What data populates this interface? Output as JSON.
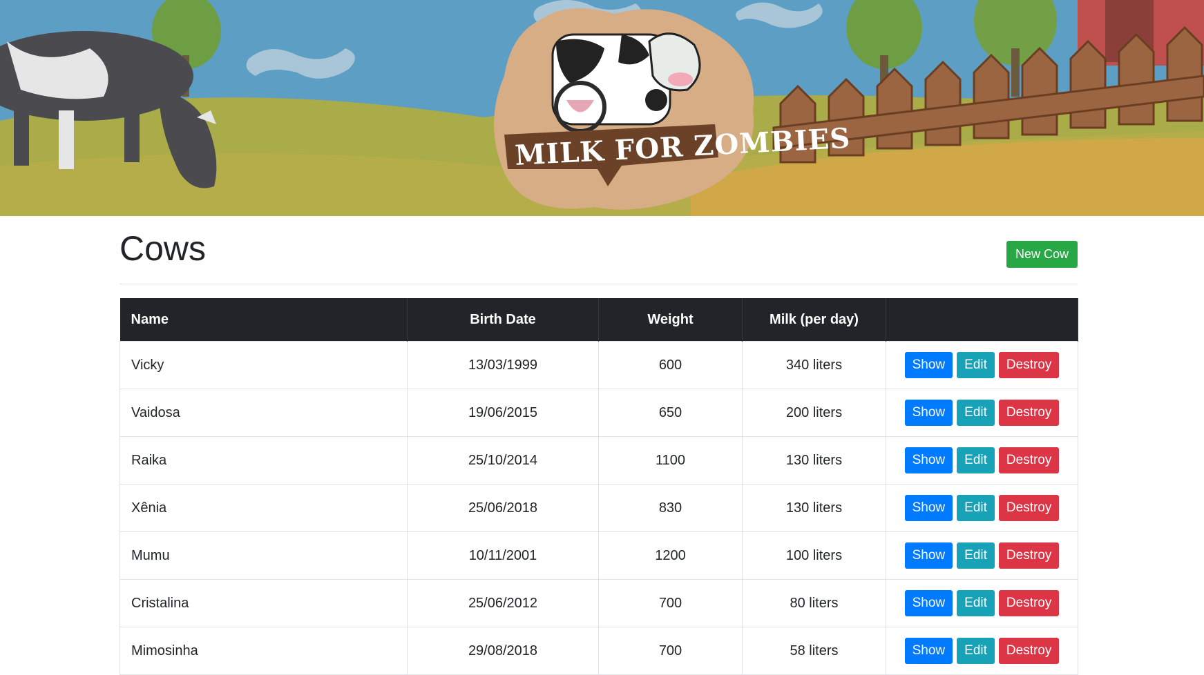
{
  "banner": {
    "logo_text": "MILK FOR ZOMBIES"
  },
  "page": {
    "title": "Cows",
    "new_button": "New Cow"
  },
  "table": {
    "headers": [
      "Name",
      "Birth Date",
      "Weight",
      "Milk (per day)",
      ""
    ],
    "rows": [
      {
        "name": "Vicky",
        "birth_date": "13/03/1999",
        "weight": "600",
        "milk": "340 liters"
      },
      {
        "name": "Vaidosa",
        "birth_date": "19/06/2015",
        "weight": "650",
        "milk": "200 liters"
      },
      {
        "name": "Raika",
        "birth_date": "25/10/2014",
        "weight": "1100",
        "milk": "130 liters"
      },
      {
        "name": "Xênia",
        "birth_date": "25/06/2018",
        "weight": "830",
        "milk": "130 liters"
      },
      {
        "name": "Mumu",
        "birth_date": "10/11/2001",
        "weight": "1200",
        "milk": "100 liters"
      },
      {
        "name": "Cristalina",
        "birth_date": "25/06/2012",
        "weight": "700",
        "milk": "80 liters"
      },
      {
        "name": "Mimosinha",
        "birth_date": "29/08/2018",
        "weight": "700",
        "milk": "58 liters"
      }
    ],
    "actions": {
      "show": "Show",
      "edit": "Edit",
      "destroy": "Destroy"
    }
  },
  "colors": {
    "header_bg": "#212529",
    "success": "#28a745",
    "primary": "#007bff",
    "info": "#17a2b8",
    "danger": "#dc3545"
  }
}
